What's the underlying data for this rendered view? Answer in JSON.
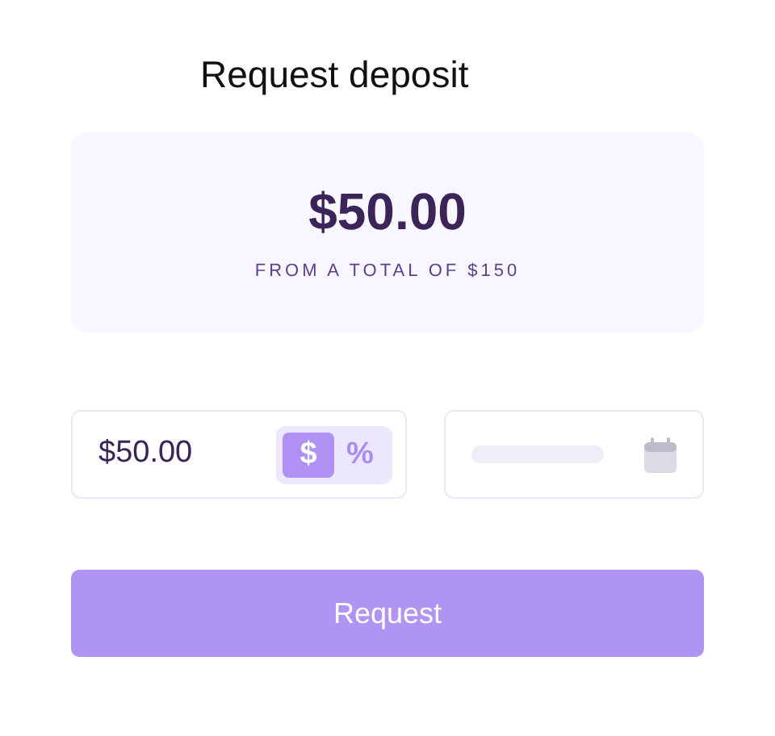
{
  "title": "Request deposit",
  "summary": {
    "amount": "$50.00",
    "caption": "FROM A TOTAL OF $150"
  },
  "amount_field": {
    "value": "$50.00"
  },
  "unit_toggle": [
    {
      "label": "$",
      "selected": true
    },
    {
      "label": "%",
      "selected": false
    }
  ],
  "submit": {
    "label": "Request"
  }
}
